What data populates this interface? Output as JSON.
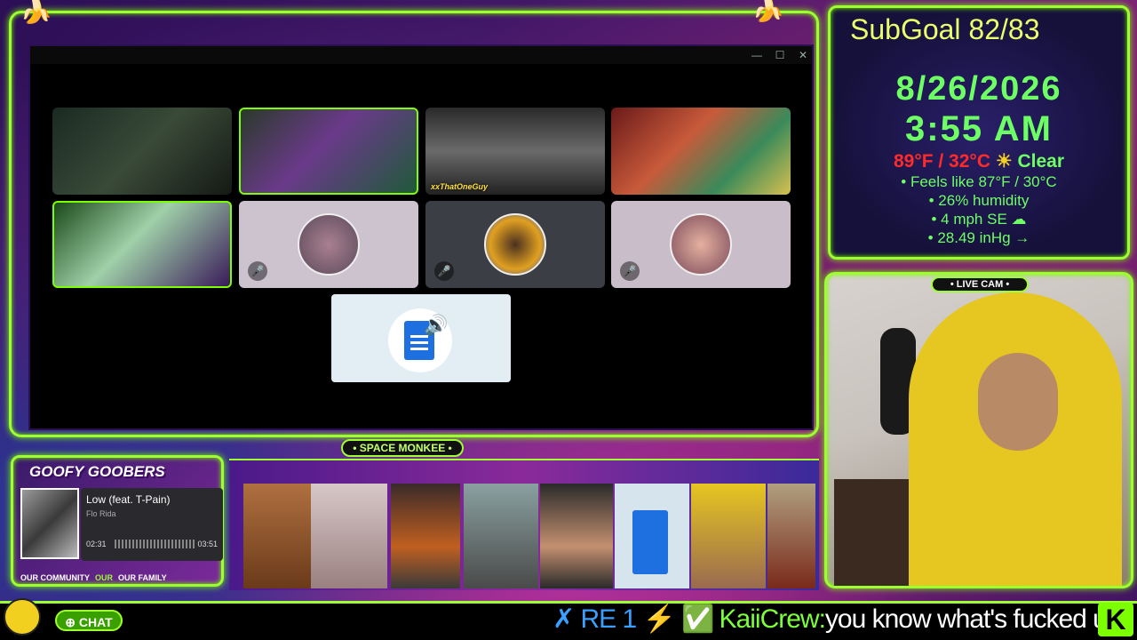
{
  "window": {
    "minimize": "—",
    "maximize": "☐",
    "close": "✕"
  },
  "tiles": [
    {
      "label": ""
    },
    {
      "label": ""
    },
    {
      "label": "xxThatOneGuy"
    },
    {
      "label": ""
    },
    {
      "label": ""
    },
    {
      "label": ""
    },
    {
      "label": ""
    },
    {
      "label": ""
    }
  ],
  "icons": {
    "mic_off": "🎤",
    "speaker": "🔊"
  },
  "weather": {
    "subgoal": "SubGoal 82/83",
    "date": "8/26/2026",
    "time": "3:55 AM",
    "temp_f_c": "89°F / 32°C",
    "sun_icon": "☀",
    "condition": "Clear",
    "feels_like": "• Feels like 87°F / 30°C",
    "humidity": "• 26% humidity",
    "wind": "• 4 mph SE ☁",
    "pressure": "• 28.49 inHg →"
  },
  "cam": {
    "badge": "• LIVE CAM •"
  },
  "space_monkee": {
    "badge": "• SPACE MONKEE •"
  },
  "music": {
    "banner": "GOOFY GOOBERS",
    "song": "Low (feat. T-Pain)",
    "artist": "Flo Rida",
    "elapsed": "02:31",
    "total": "03:51",
    "progress": 0.65,
    "community_left": "OUR COMMUNITY",
    "community_mid": "OUR",
    "community_right": "OUR FAMILY"
  },
  "chat": {
    "button": "⊕ CHAT",
    "badges": "✗ RE 1 ⚡ ✅",
    "username": "KaiiCrew:",
    "message": "you know what's fucked up"
  },
  "logo": {
    "k": "K"
  },
  "colors": {
    "neon_green": "#9dff2f",
    "weather_green": "#6dff64",
    "temp_red": "#ff2a2a",
    "subgoal_yellow": "#eaff6a"
  }
}
